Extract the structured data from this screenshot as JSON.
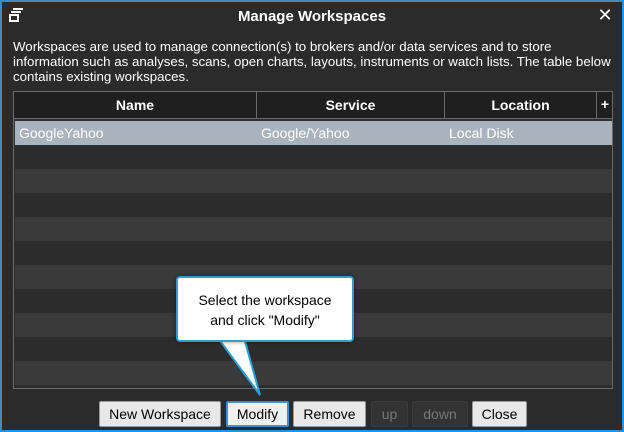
{
  "window": {
    "title": "Manage Workspaces",
    "close_glyph": "✕"
  },
  "description": "Workspaces are used to manage connection(s) to brokers and/or data services and to store information such as analyses, scans, open charts, layouts, instruments or watch lists. The table below contains existing workspaces.",
  "table": {
    "columns": [
      "Name",
      "Service",
      "Location"
    ],
    "add_column_glyph": "+",
    "rows": [
      {
        "name": "GoogleYahoo",
        "service": "Google/Yahoo",
        "location": "Local Disk",
        "selected": true
      }
    ]
  },
  "buttons": {
    "new_workspace": "New Workspace",
    "modify": "Modify",
    "remove": "Remove",
    "up": "up",
    "down": "down",
    "close": "Close"
  },
  "callout": {
    "line1": "Select the workspace",
    "line2": "and click \"Modify\""
  },
  "colors": {
    "accent": "#2f8fd0",
    "dialog_bg": "#2b2b2b",
    "selected_row": "#a9b3bd"
  },
  "icons": {
    "app": "workspace-stack-icon",
    "close": "close-icon",
    "add_column": "plus-icon"
  }
}
